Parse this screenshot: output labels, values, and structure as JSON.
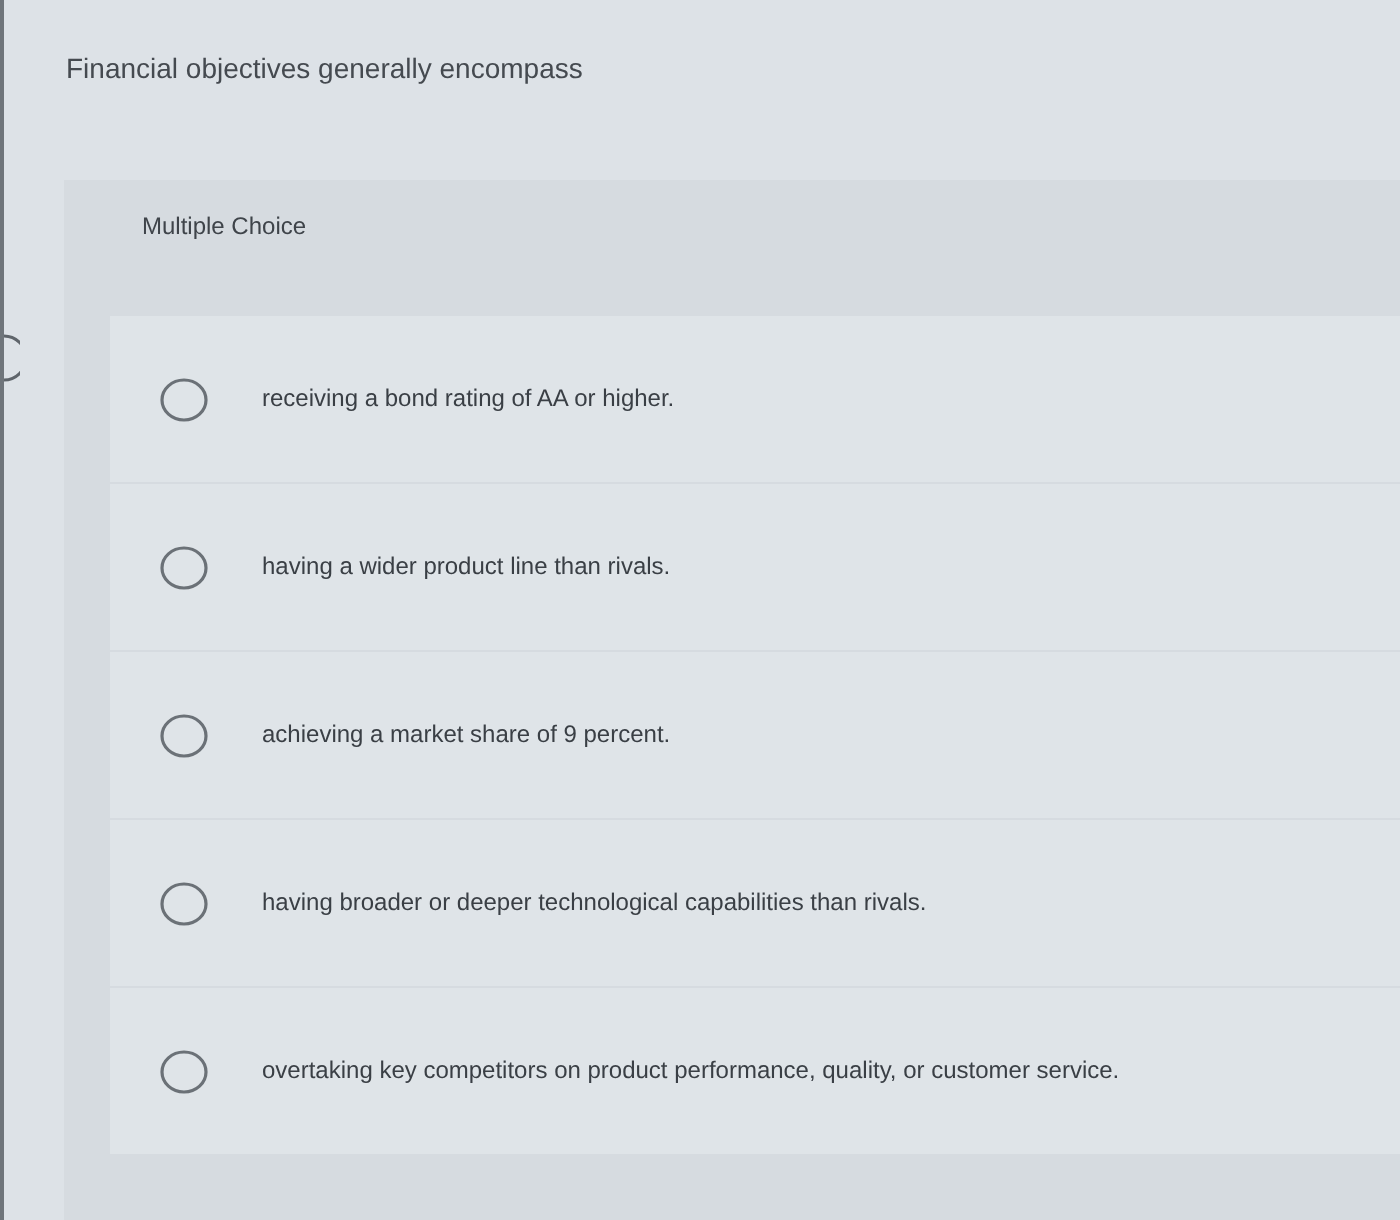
{
  "question": {
    "prompt": "Financial objectives generally encompass"
  },
  "answer_panel": {
    "label": "Multiple Choice",
    "options": [
      {
        "text": "receiving a bond rating of AA or higher.",
        "selected": false
      },
      {
        "text": "having a wider product line than rivals.",
        "selected": false
      },
      {
        "text": "achieving a market share of 9 percent.",
        "selected": false
      },
      {
        "text": "having broader or deeper technological capabilities than rivals.",
        "selected": false
      },
      {
        "text": "overtaking key competitors on product performance, quality, or customer service.",
        "selected": false
      }
    ]
  }
}
